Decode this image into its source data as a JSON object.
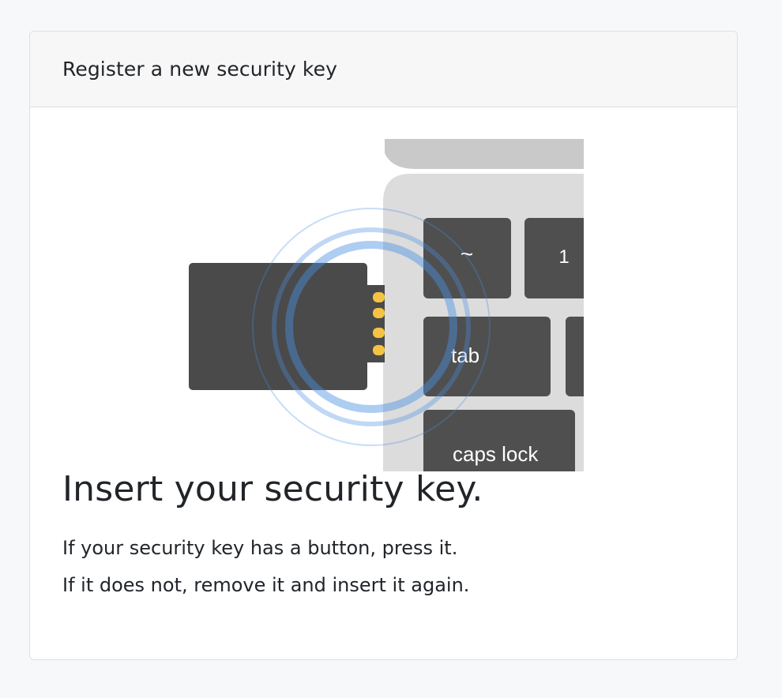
{
  "card": {
    "title": "Register a new security key"
  },
  "illustration": {
    "keys": {
      "tilde": "~",
      "one": "1",
      "tab": "tab",
      "caps_lock": "caps lock"
    },
    "colors": {
      "key_body": "#4a4a4a",
      "contacts": "#f5c342",
      "keyboard_bg": "#dcdcdc",
      "keyboard_top": "#c9c9c9",
      "ripple": "#4a90e2"
    }
  },
  "main": {
    "headline": "Insert your security key.",
    "instruction_1": "If your security key has a button, press it.",
    "instruction_2": "If it does not, remove it and insert it again."
  }
}
